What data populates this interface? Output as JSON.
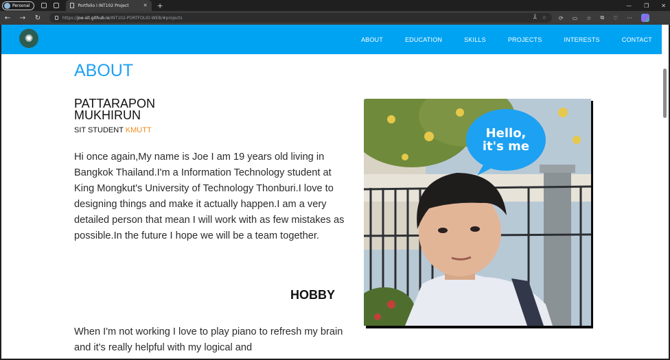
{
  "browser": {
    "profile_label": "Personal",
    "tab_title": "Portfolio I INT102 Project",
    "url_prefix": "https://",
    "url_host": "joe-sit.github.io",
    "url_path": "/INT102-PORTFOLIO-WEB/#projects"
  },
  "nav": {
    "items": [
      "ABOUT",
      "EDUCATION",
      "SKILLS",
      "PROJECTS",
      "INTERESTS",
      "CONTACT"
    ]
  },
  "about": {
    "heading": "ABOUT",
    "name_line1": "PATTARAPON",
    "name_line2": "MUKHIRUN",
    "role_prefix": "SIT STUDENT ",
    "role_highlight": "KMUTT",
    "bio": "Hi once again,My name is Joe I am 19 years old living in Bangkok Thailand.I'm a Information Technology student at King Mongkut's University of Technology Thonburi.I love to designing things and make it actually happen.I am a very detailed person that mean I will work with as few mistakes as possible.In the future I hope we will be a team together.",
    "hobby_heading": "HOBBY",
    "hobby_text": "When I'm not working I love to play piano to refresh my brain and it's really helpful with my logical and",
    "photo_bubble_line1": "Hello,",
    "photo_bubble_line2": "it's me"
  },
  "colors": {
    "header_bg": "#00a2f2",
    "heading_blue": "#1da1f2",
    "accent_orange": "#f28a1c"
  }
}
